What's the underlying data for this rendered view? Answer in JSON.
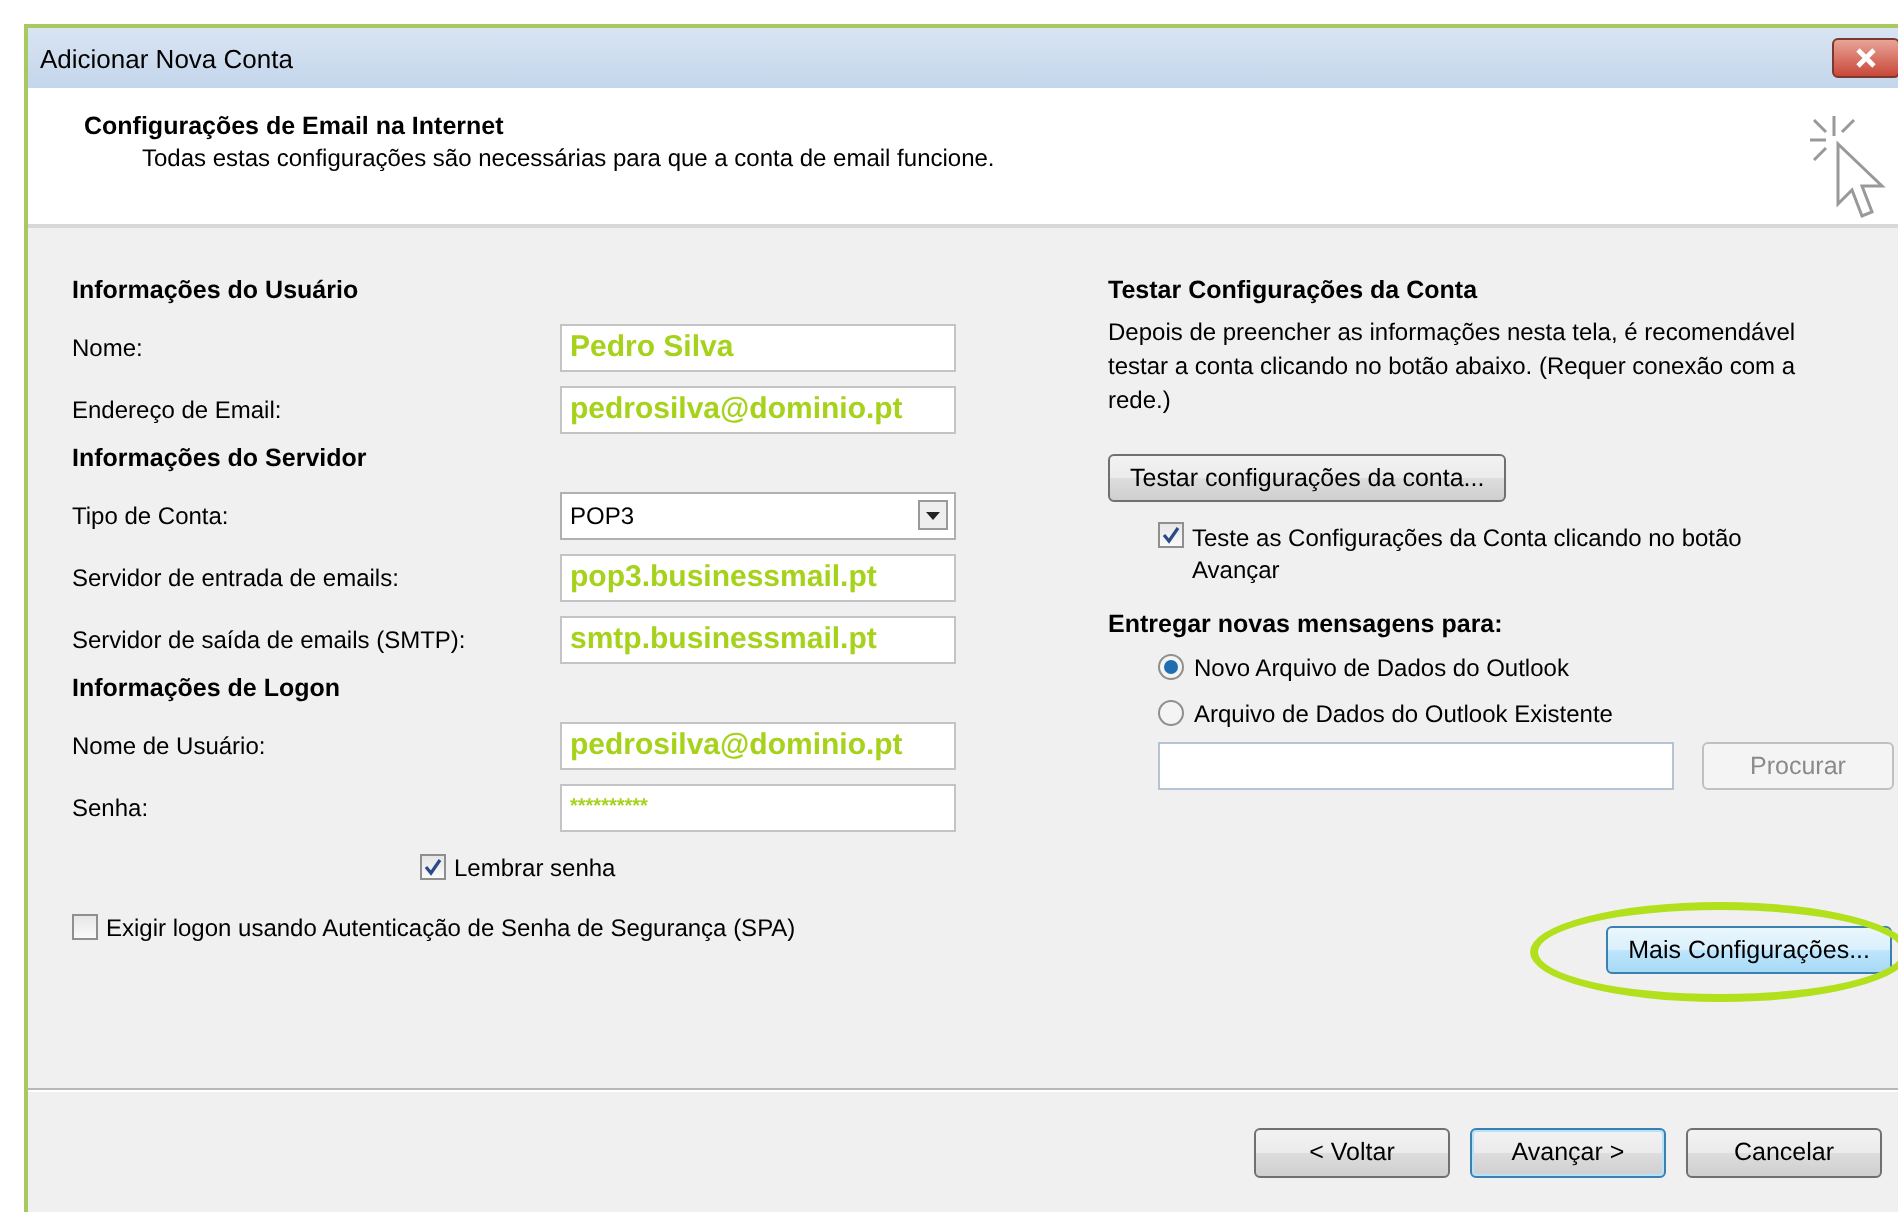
{
  "window": {
    "title": "Adicionar Nova Conta"
  },
  "header": {
    "title": "Configurações de Email na Internet",
    "subtitle": "Todas estas configurações são necessárias para que a conta de email funcione."
  },
  "left_sections": [
    {
      "heading": "Informações do Usuário",
      "rows": [
        {
          "label": "Nome:",
          "kind": "text",
          "value": "Pedro Silva"
        },
        {
          "label": "Endereço de Email:",
          "kind": "text",
          "value": "pedrosilva@dominio.pt"
        }
      ]
    },
    {
      "heading": "Informações do Servidor",
      "rows": [
        {
          "label": "Tipo de Conta:",
          "kind": "select",
          "value": "POP3"
        },
        {
          "label": "Servidor de entrada de emails:",
          "kind": "text",
          "value": "pop3.businessmail.pt"
        },
        {
          "label": "Servidor de saída de emails (SMTP):",
          "kind": "text",
          "value": "smtp.businessmail.pt"
        }
      ]
    },
    {
      "heading": "Informações de Logon",
      "rows": [
        {
          "label": "Nome de Usuário:",
          "kind": "text",
          "value": "pedrosilva@dominio.pt"
        },
        {
          "label": "Senha:",
          "kind": "password",
          "value": "**********"
        }
      ]
    }
  ],
  "remember_password": {
    "label": "Lembrar senha",
    "checked": true
  },
  "spa": {
    "label": "Exigir logon usando Autenticação de Senha de Segurança (SPA)",
    "checked": false
  },
  "test": {
    "heading": "Testar Configurações da Conta",
    "description": "Depois de preencher as informações nesta tela, é recomendável testar a conta clicando no botão abaixo. (Requer conexão com a rede.)",
    "button": "Testar configurações da conta...",
    "checkbox": {
      "label": "Teste as Configurações da Conta clicando no botão Avançar",
      "checked": true
    }
  },
  "deliver": {
    "heading": "Entregar novas mensagens para:",
    "options": [
      {
        "label": "Novo Arquivo de Dados do Outlook",
        "selected": true
      },
      {
        "label": "Arquivo de Dados do Outlook Existente",
        "selected": false
      }
    ],
    "browse_button": {
      "label": "Procurar",
      "disabled": true
    }
  },
  "more_settings": {
    "label": "Mais Configurações...",
    "highlighted": true
  },
  "footer_buttons": [
    {
      "label": "< Voltar",
      "default": false
    },
    {
      "label": "Avançar >",
      "default": true
    },
    {
      "label": "Cancelar",
      "default": false
    }
  ]
}
